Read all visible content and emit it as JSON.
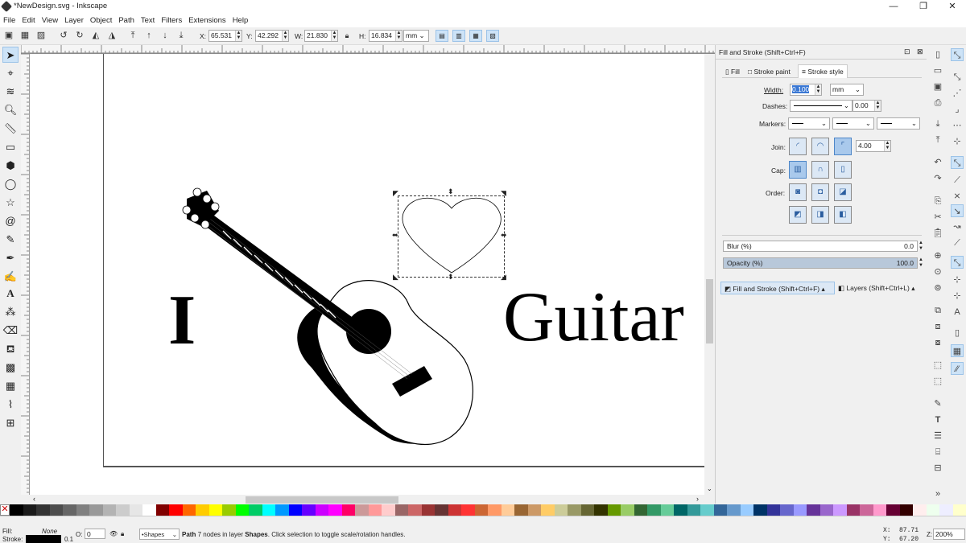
{
  "window": {
    "title": "*NewDesign.svg - Inkscape",
    "minimize": "—",
    "restore": "❐",
    "close": "✕"
  },
  "menu": [
    "File",
    "Edit",
    "View",
    "Layer",
    "Object",
    "Path",
    "Text",
    "Filters",
    "Extensions",
    "Help"
  ],
  "toolbar": {
    "x_label": "X:",
    "x_value": "65.531",
    "y_label": "Y:",
    "y_value": "42.292",
    "w_label": "W:",
    "w_value": "21.830",
    "h_label": "H:",
    "h_value": "16.834",
    "unit": "mm"
  },
  "canvas": {
    "text_left": "I",
    "text_right": "Guitar"
  },
  "dock": {
    "panel_title": "Fill and Stroke (Shift+Ctrl+F)",
    "tabs": [
      "Fill",
      "Stroke paint",
      "Stroke style"
    ],
    "width_label": "Width:",
    "width_value": "0.100",
    "width_unit": "mm",
    "dashes_label": "Dashes:",
    "dashes_value": "0.00",
    "markers_label": "Markers:",
    "join_label": "Join:",
    "join_value": "4.00",
    "cap_label": "Cap:",
    "order_label": "Order:",
    "blur_label": "Blur (%)",
    "blur_value": "0.0",
    "opacity_label": "Opacity (%)",
    "opacity_value": "100.0",
    "bottom_tab1": "Fill and Stroke (Shift+Ctrl+F)",
    "bottom_tab2": "Layers (Shift+Ctrl+L)"
  },
  "palette_colors": [
    "#000000",
    "#1a1a1a",
    "#333333",
    "#4d4d4d",
    "#666666",
    "#808080",
    "#999999",
    "#b3b3b3",
    "#cccccc",
    "#e6e6e6",
    "#ffffff",
    "#800000",
    "#ff0000",
    "#ff6600",
    "#ffcc00",
    "#ffff00",
    "#99cc00",
    "#00ff00",
    "#00cc66",
    "#00ffff",
    "#0099ff",
    "#0000ff",
    "#6600ff",
    "#cc00ff",
    "#ff00ff",
    "#ff0066",
    "#cc9999",
    "#ff9999",
    "#ffcccc",
    "#996666",
    "#cc6666",
    "#993333",
    "#663333",
    "#cc3333",
    "#ff3333",
    "#cc6633",
    "#ff9966",
    "#ffcc99",
    "#996633",
    "#cc9966",
    "#ffcc66",
    "#cccc99",
    "#999966",
    "#666633",
    "#333300",
    "#669900",
    "#99cc66",
    "#336633",
    "#339966",
    "#66cc99",
    "#006666",
    "#339999",
    "#66cccc",
    "#336699",
    "#6699cc",
    "#99ccff",
    "#003366",
    "#333399",
    "#6666cc",
    "#9999ff",
    "#663399",
    "#9966cc",
    "#cc99ff",
    "#993366",
    "#cc6699",
    "#ff99cc",
    "#660033",
    "#330000",
    "#ffeeee",
    "#eeffee",
    "#eeeeff",
    "#ffffcc"
  ],
  "status": {
    "fill_label": "Fill:",
    "fill_value": "None",
    "stroke_label": "Stroke:",
    "stroke_width": "0.1",
    "opacity_label": "O:",
    "opacity_value": "0",
    "layer": "•Shapes",
    "message_bold": "Path",
    "message": " 7 nodes in layer ",
    "message_layer": "Shapes",
    "message_tail": ". Click selection to toggle scale/rotation handles.",
    "x_label": "X:",
    "x_value": "87.71",
    "y_label": "Y:",
    "y_value": "67.20",
    "z_label": "Z:",
    "zoom": "200%"
  }
}
